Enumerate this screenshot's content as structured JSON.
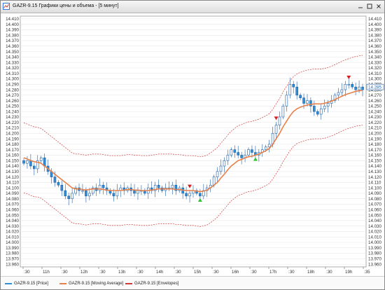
{
  "window": {
    "title": "GAZR-9.15 Графики цены и объема - [5 минут]"
  },
  "colors": {
    "candle_up": "#2e8fd6",
    "candle_down": "#1f5fa8",
    "moving_average": "#e8804a",
    "envelopes": "#d03a3a",
    "signal_sell": "#d42020",
    "signal_buy": "#2fbf2f",
    "grid": "#e6e6e6"
  },
  "legend": [
    {
      "label": "GAZR-9.15 [Price]",
      "color": "#2e8fd6"
    },
    {
      "label": "GAZR-9.15 [Moving Average]",
      "color": "#e8804a"
    },
    {
      "label": "GAZR-9.15 [Envelopes]",
      "color": "#d03a3a"
    }
  ],
  "chart_data": {
    "type": "candlestick",
    "y_ticks": [
      "14.410",
      "14.400",
      "14.390",
      "14.380",
      "14.370",
      "14.360",
      "14.350",
      "14.340",
      "14.330",
      "14.320",
      "14.310",
      "14.300",
      "14.290",
      "14.280",
      "14.270",
      "14.260",
      "14.250",
      "14.240",
      "14.230",
      "14.220",
      "14.210",
      "14.200",
      "14.190",
      "14.180",
      "14.170",
      "14.160",
      "14.150",
      "14.140",
      "14.130",
      "14.120",
      "14.110",
      "14.100",
      "14.090",
      "14.080",
      "14.070",
      "14.060",
      "14.050",
      "14.040",
      "14.030",
      "14.020",
      "14.010",
      "14.000",
      "13.990",
      "13.980",
      "13.970",
      "13.960"
    ],
    "ylim": [
      13.955,
      14.415
    ],
    "x_ticks": [
      ":30",
      "11h",
      ":30",
      "12h",
      ":30",
      "13h",
      ":30",
      "14h",
      ":30",
      "15h",
      ":30",
      "16h",
      ":30",
      "17h",
      ":30",
      "18h",
      ":30",
      "19h",
      ":35"
    ],
    "price_label": "14.285",
    "candles_close": [
      14.145,
      14.15,
      14.14,
      14.135,
      14.15,
      14.155,
      14.14,
      14.13,
      14.12,
      14.11,
      14.105,
      14.095,
      14.085,
      14.08,
      14.09,
      14.1,
      14.095,
      14.095,
      14.085,
      14.09,
      14.1,
      14.095,
      14.105,
      14.1,
      14.095,
      14.09,
      14.085,
      14.095,
      14.1,
      14.095,
      14.1,
      14.095,
      14.09,
      14.095,
      14.095,
      14.09,
      14.1,
      14.095,
      14.105,
      14.1,
      14.095,
      14.1,
      14.1,
      14.105,
      14.095,
      14.1,
      14.09,
      14.085,
      14.09,
      14.095,
      14.09,
      14.085,
      14.095,
      14.1,
      14.105,
      14.12,
      14.13,
      14.14,
      14.15,
      14.16,
      14.17,
      14.165,
      14.16,
      14.155,
      14.16,
      14.17,
      14.165,
      14.16,
      14.165,
      14.17,
      14.175,
      14.18,
      14.2,
      14.215,
      14.23,
      14.25,
      14.27,
      14.29,
      14.285,
      14.27,
      14.265,
      14.255,
      14.26,
      14.25,
      14.24,
      14.235,
      14.245,
      14.25,
      14.255,
      14.26,
      14.27,
      14.275,
      14.28,
      14.29,
      14.29,
      14.285,
      14.28,
      14.285,
      14.28
    ],
    "moving_average": [
      14.155,
      14.153,
      14.15,
      14.148,
      14.147,
      14.145,
      14.14,
      14.135,
      14.13,
      14.125,
      14.12,
      14.115,
      14.11,
      14.105,
      14.1,
      14.098,
      14.098,
      14.097,
      14.096,
      14.097,
      14.098,
      14.098,
      14.098,
      14.097,
      14.096,
      14.095,
      14.095,
      14.095,
      14.095,
      14.096,
      14.097,
      14.097,
      14.096,
      14.096,
      14.095,
      14.095,
      14.095,
      14.096,
      14.097,
      14.098,
      14.098,
      14.098,
      14.098,
      14.098,
      14.097,
      14.097,
      14.096,
      14.095,
      14.095,
      14.095,
      14.094,
      14.093,
      14.094,
      14.096,
      14.1,
      14.105,
      14.11,
      14.118,
      14.125,
      14.133,
      14.14,
      14.145,
      14.15,
      14.152,
      14.155,
      14.157,
      14.158,
      14.16,
      14.162,
      14.165,
      14.168,
      14.172,
      14.18,
      14.19,
      14.2,
      14.212,
      14.222,
      14.232,
      14.24,
      14.245,
      14.248,
      14.25,
      14.252,
      14.253,
      14.254,
      14.254,
      14.254,
      14.255,
      14.257,
      14.259,
      14.262,
      14.265,
      14.268,
      14.271,
      14.273,
      14.275,
      14.277,
      14.278,
      14.279
    ],
    "envelope_offset": 0.064
  }
}
